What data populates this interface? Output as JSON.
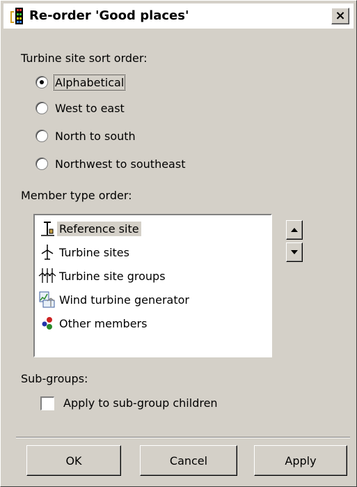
{
  "dialog": {
    "title": "Re-order 'Good places'",
    "close_glyph": "×"
  },
  "sort_order": {
    "label": "Turbine site sort order:",
    "selected": "Alphabetical",
    "options": [
      {
        "label": "Alphabetical",
        "checked": true
      },
      {
        "label": "West to east",
        "checked": false
      },
      {
        "label": "North to south",
        "checked": false
      },
      {
        "label": "Northwest to southeast",
        "checked": false
      }
    ]
  },
  "member_order": {
    "label": "Member type order:",
    "items": [
      {
        "label": "Reference site",
        "icon": "reference-site-icon",
        "selected": true
      },
      {
        "label": "Turbine sites",
        "icon": "turbine-site-icon",
        "selected": false
      },
      {
        "label": "Turbine site groups",
        "icon": "turbine-group-icon",
        "selected": false
      },
      {
        "label": "Wind turbine generator",
        "icon": "wind-turbine-generator-icon",
        "selected": false
      },
      {
        "label": "Other members",
        "icon": "other-members-icon",
        "selected": false
      }
    ],
    "move_up_icon": "arrow-up-icon",
    "move_down_icon": "arrow-down-icon"
  },
  "subgroups": {
    "label": "Sub-groups:",
    "checkbox_label": "Apply to sub-group children",
    "checked": false
  },
  "buttons": {
    "ok": "OK",
    "cancel": "Cancel",
    "apply": "Apply"
  },
  "colors": {
    "dialog_face": "#d4d0c8",
    "title_background": "#ffffff",
    "list_background": "#ffffff",
    "icon_red": "#cc2222",
    "icon_green": "#2a8a2a",
    "icon_blue": "#2233aa"
  }
}
